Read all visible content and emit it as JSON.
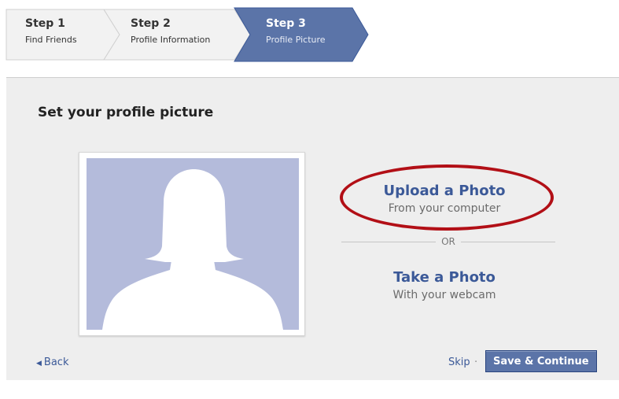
{
  "steps": [
    {
      "title": "Step 1",
      "subtitle": "Find Friends",
      "state": "done"
    },
    {
      "title": "Step 2",
      "subtitle": "Profile Information",
      "state": "done"
    },
    {
      "title": "Step 3",
      "subtitle": "Profile Picture",
      "state": "active"
    }
  ],
  "panel": {
    "title": "Set your profile picture"
  },
  "upload": {
    "title": "Upload a Photo",
    "subtitle": "From your computer"
  },
  "divider": "OR",
  "take": {
    "title": "Take a Photo",
    "subtitle": "With your webcam"
  },
  "footer": {
    "back": "Back",
    "skip": "Skip",
    "separator": "·",
    "save": "Save & Continue"
  },
  "colors": {
    "brand": "#3b5998",
    "button": "#5b74a8",
    "active_step": "#5b74a8",
    "photo_bg": "#b4bbdb",
    "highlight": "#b20f16",
    "panel_bg": "#eeeeee"
  },
  "icons": {
    "back": "triangle-left-icon",
    "avatar": "default-female-silhouette"
  }
}
